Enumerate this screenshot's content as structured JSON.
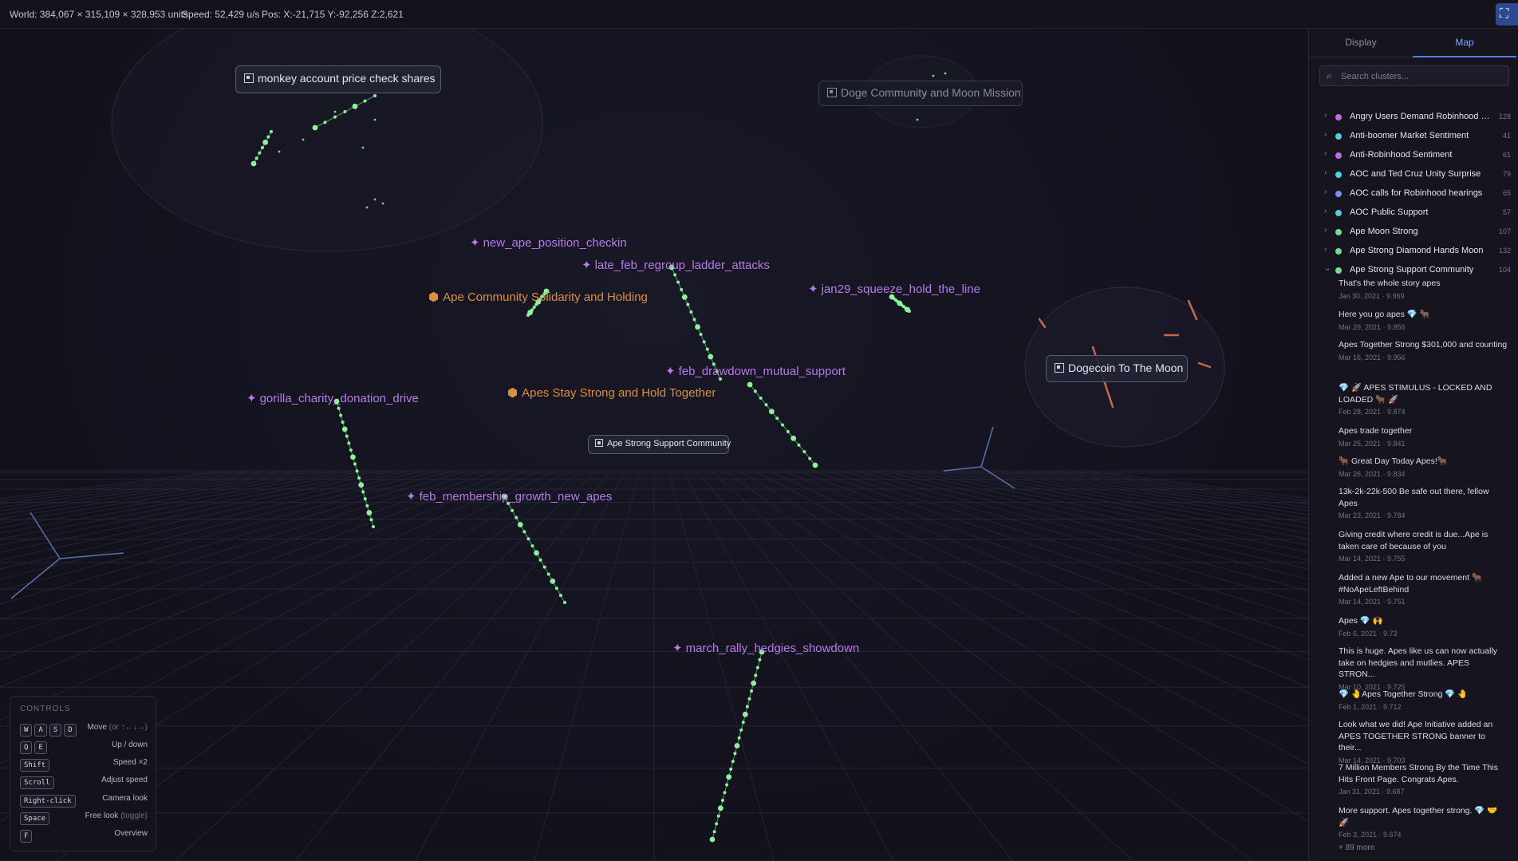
{
  "topbar": {
    "world": "World: 384,067 × 315,109 × 328,953 units",
    "speed": "Speed: 52,429 u/s",
    "pos": "Pos: X:-21,715 Y:-92,256 Z:2,621",
    "corner_icon": "collapse-icon"
  },
  "scene": {
    "box_labels": [
      {
        "id": "monkey",
        "text": "monkey account price check shares",
        "faded": false
      },
      {
        "id": "doge-mission",
        "text": "Doge Community and Moon Mission",
        "faded": true
      },
      {
        "id": "dogecoin-moon",
        "text": "Dogecoin To The Moon",
        "faded": false
      },
      {
        "id": "ape-strong-support",
        "text": "Ape Strong Support Community",
        "faded": false
      }
    ],
    "star_labels": [
      {
        "id": "new-ape",
        "text": "new_ape_position_checkin"
      },
      {
        "id": "late-feb",
        "text": "late_feb_regroup_ladder_attacks"
      },
      {
        "id": "jan29",
        "text": "jan29_squeeze_hold_the_line"
      },
      {
        "id": "feb-drawdown",
        "text": "feb_drawdown_mutual_support"
      },
      {
        "id": "gorilla",
        "text": "gorilla_charity_donation_drive"
      },
      {
        "id": "feb-membership",
        "text": "feb_membership_growth_new_apes"
      },
      {
        "id": "march-rally",
        "text": "march_rally_hedgies_showdown"
      }
    ],
    "hex_labels": [
      {
        "id": "solidarity",
        "text": "Ape Community Solidarity and Holding"
      },
      {
        "id": "stay-strong",
        "text": "Apes Stay Strong and Hold Together"
      }
    ],
    "star_glyph": "✦",
    "hex_glyph": "⬢"
  },
  "controls": {
    "title": "CONTROLS",
    "rows": [
      {
        "keys": [
          "W",
          "A",
          "S",
          "D"
        ],
        "desc": "Move",
        "hint": "(or ↑←↓→)"
      },
      {
        "keys": [
          "Q",
          "E"
        ],
        "desc": "Up / down",
        "hint": ""
      },
      {
        "keys": [
          "Shift"
        ],
        "desc": "Speed ×2",
        "hint": ""
      },
      {
        "keys": [
          "Scroll"
        ],
        "desc": "Adjust speed",
        "hint": ""
      },
      {
        "keys": [
          "Right-click"
        ],
        "desc": "Camera look",
        "hint": ""
      },
      {
        "keys": [
          "Space"
        ],
        "desc": "Free look",
        "hint": "(toggle)"
      },
      {
        "keys": [
          "F"
        ],
        "desc": "Overview",
        "hint": ""
      }
    ]
  },
  "sidebar": {
    "tabs": {
      "display": "Display",
      "map": "Map"
    },
    "search_placeholder": "Search clusters...",
    "clusters": [
      {
        "name": "Angry Users Demand Robinhood C...",
        "count": "128",
        "color": "#c06be0",
        "expanded": false
      },
      {
        "name": "Anti-boomer Market Sentiment",
        "count": "41",
        "color": "#4fd1d9",
        "expanded": false
      },
      {
        "name": "Anti-Robinhood Sentiment",
        "count": "61",
        "color": "#c06be0",
        "expanded": false
      },
      {
        "name": "AOC and Ted Cruz Unity Surprise",
        "count": "79",
        "color": "#4fd1d9",
        "expanded": false
      },
      {
        "name": "AOC calls for Robinhood hearings",
        "count": "65",
        "color": "#7d8cf0",
        "expanded": false
      },
      {
        "name": "AOC Public Support",
        "count": "57",
        "color": "#4fd1d9",
        "expanded": false
      },
      {
        "name": "Ape Moon Strong",
        "count": "107",
        "color": "#6fe08a",
        "expanded": false
      },
      {
        "name": "Ape Strong Diamond Hands Moon",
        "count": "132",
        "color": "#6fe08a",
        "expanded": false
      },
      {
        "name": "Ape Strong Support Community",
        "count": "104",
        "color": "#6fe08a",
        "expanded": true
      }
    ],
    "posts": [
      {
        "title": "That's the whole story apes",
        "meta": "Jan 30, 2021 · 9.969"
      },
      {
        "title": "Here you go apes 💎 🐂",
        "meta": "Mar 29, 2021 · 9.956"
      },
      {
        "title": "Apes Together Strong $301,000 and counting",
        "meta": "Mar 16, 2021 · 9.956"
      },
      {
        "title": "💎 🚀 APES STIMULUS - LOCKED AND LOADED 🐂 🚀",
        "meta": "Feb 28, 2021 · 9.874"
      },
      {
        "title": "Apes trade together",
        "meta": "Mar 25, 2021 · 9.841"
      },
      {
        "title": "🐂 Great Day Today Apes!🐂",
        "meta": "Mar 26, 2021 · 9.834"
      },
      {
        "title": "13k-2k-22k-500 Be safe out there, fellow Apes",
        "meta": "Mar 23, 2021 · 9.784"
      },
      {
        "title": "Giving credit where credit is due...Ape is taken care of because of you",
        "meta": "Mar 14, 2021 · 9.755"
      },
      {
        "title": "Added a new Ape to our movement 🐂 #NoApeLeftBehind",
        "meta": "Mar 14, 2021 · 9.751"
      },
      {
        "title": "Apes 💎 🙌",
        "meta": "Feb 6, 2021 · 9.73"
      },
      {
        "title": "This is huge. Apes like us can now actually take on hedgies and mutlies. APES STRON...",
        "meta": "Mar 10, 2021 · 9.725"
      },
      {
        "title": "💎 🤚Apes Together Strong 💎 🤚",
        "meta": "Feb 1, 2021 · 9.712"
      },
      {
        "title": "Look what we did! Ape Initiative added an APES TOGETHER STRONG banner to their...",
        "meta": "Mar 14, 2021 · 9.703"
      },
      {
        "title": "7 Million Members Strong By the Time This Hits Front Page. Congrats Apes.",
        "meta": "Jan 31, 2021 · 9.687"
      },
      {
        "title": "More support. Apes together strong. 💎 🤝 🚀",
        "meta": "Feb 3, 2021 · 9.674"
      }
    ],
    "more": "+ 89 more"
  }
}
